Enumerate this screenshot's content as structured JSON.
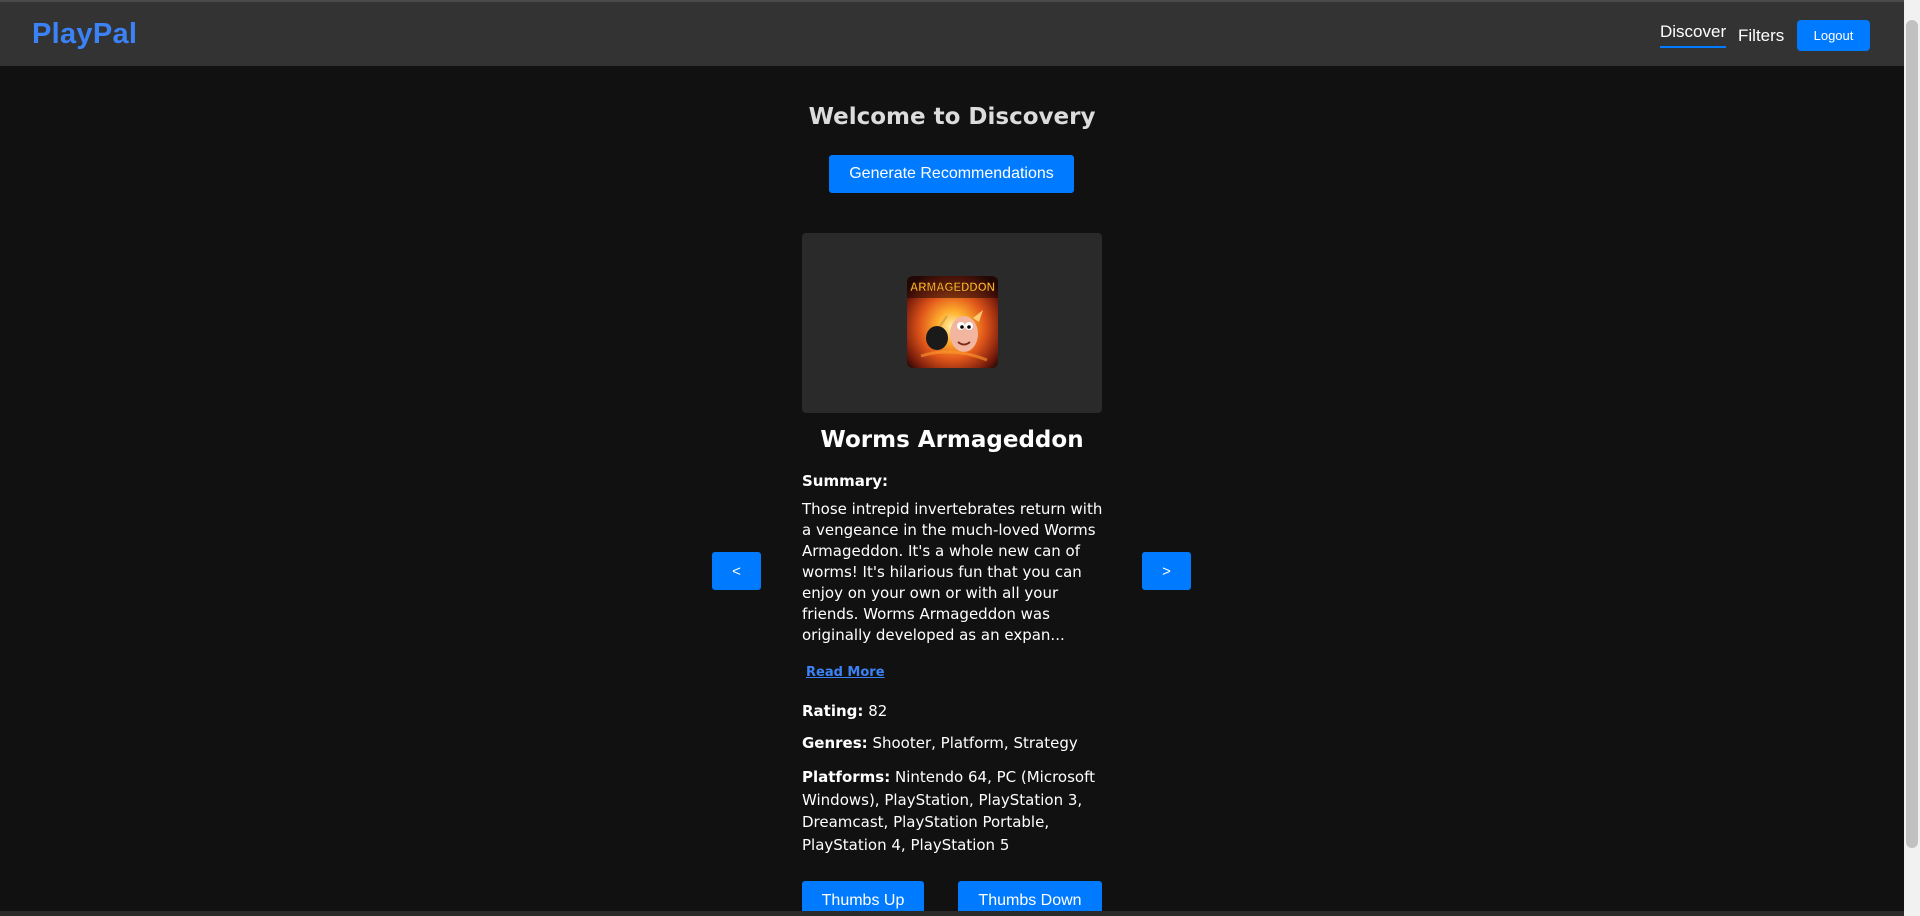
{
  "header": {
    "brand": "PlayPal",
    "nav": {
      "discover": "Discover",
      "filters": "Filters",
      "logout": "Logout"
    }
  },
  "main": {
    "welcome": "Welcome to Discovery",
    "generate_label": "Generate Recommendations",
    "prev_label": "<",
    "next_label": ">",
    "game": {
      "cover_text": "ARMAGEDDON",
      "title": "Worms Armageddon",
      "summary_label": "Summary:",
      "summary": "Those intrepid invertebrates return with a vengeance in the much-loved Worms Armageddon. It's a whole new can of worms! It's hilarious fun that you can enjoy on your own or with all your friends. Worms Armageddon was originally developed as an expan...",
      "read_more": "Read More",
      "rating_label": "Rating:",
      "rating": "82",
      "genres_label": "Genres:",
      "genres": "Shooter, Platform, Strategy",
      "platforms_label": "Platforms:",
      "platforms": "Nintendo 64, PC (Microsoft Windows), PlayStation, PlayStation 3, Dreamcast, PlayStation Portable, PlayStation 4, PlayStation 5"
    },
    "thumbs_up": "Thumbs Up",
    "thumbs_down": "Thumbs Down"
  },
  "colors": {
    "accent": "#007bff",
    "brand": "#3b82f6",
    "background": "#111111",
    "navbar": "#333333",
    "card": "#2a2a2a"
  },
  "icons": {
    "cover": "game-cover-image"
  }
}
